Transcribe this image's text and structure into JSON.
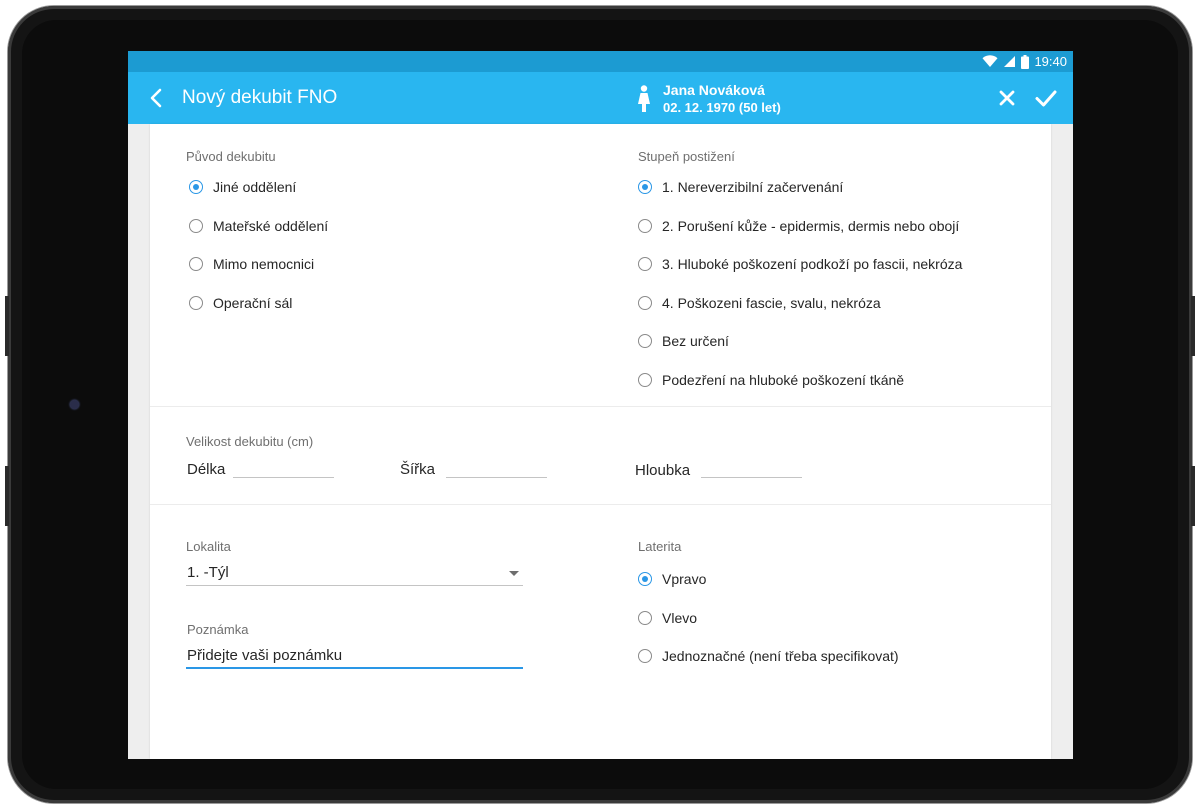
{
  "status_bar": {
    "time": "19:40"
  },
  "header": {
    "title": "Nový dekubit FNO",
    "patient_name": "Jana Nováková",
    "patient_dob": "02. 12. 1970 (50 let)"
  },
  "origin": {
    "label": "Původ dekubitu",
    "options": [
      "Jiné oddělení",
      "Mateřské oddělení",
      "Mimo nemocnici",
      "Operační sál"
    ],
    "selected": 0
  },
  "degree": {
    "label": "Stupeň postižení",
    "options": [
      "1. Nereverzibilní začervenání",
      "2. Porušení kůže - epidermis, dermis nebo obojí",
      "3. Hluboké poškození podkoží po fascii, nekróza",
      "4. Poškozeni fascie, svalu, nekróza",
      "Bez určení",
      "Podezření na hluboké poškození tkáně"
    ],
    "selected": 0
  },
  "size": {
    "label": "Velikost dekubitu (cm)",
    "length_label": "Délka",
    "width_label": "Šířka",
    "depth_label": "Hloubka"
  },
  "location": {
    "label": "Lokalita",
    "value": "1. -Týl"
  },
  "note": {
    "label": "Poznámka",
    "placeholder": "Přidejte vaši poznámku"
  },
  "laterality": {
    "label": "Laterita",
    "options": [
      "Vpravo",
      "Vlevo",
      "Jednoznačné (není třeba specifikovat)"
    ],
    "selected": 0
  },
  "colors": {
    "status_bar": "#1c9bd2",
    "app_bar": "#29b6f0",
    "accent": "#2a97e6"
  }
}
